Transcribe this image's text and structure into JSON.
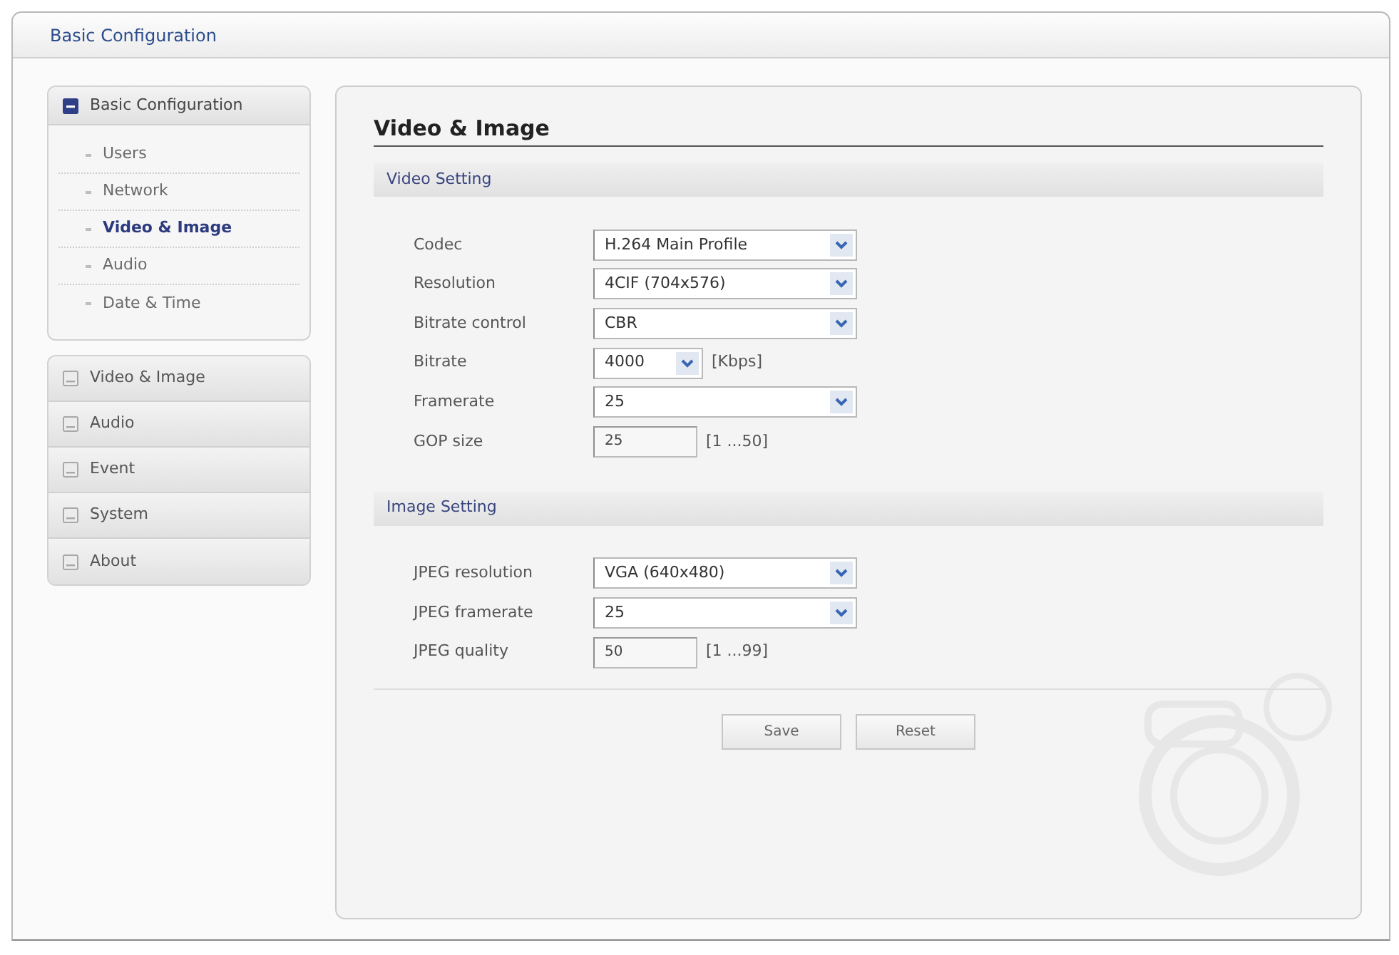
{
  "window": {
    "title": "Basic Configuration"
  },
  "sidebar": {
    "groups": [
      {
        "label": "Basic Configuration",
        "expanded": true,
        "items": [
          {
            "label": "Users",
            "selected": false
          },
          {
            "label": "Network",
            "selected": false
          },
          {
            "label": "Video & Image",
            "selected": true
          },
          {
            "label": "Audio",
            "selected": false
          },
          {
            "label": "Date & Time",
            "selected": false
          }
        ]
      },
      {
        "label": "Video & Image",
        "expanded": false
      },
      {
        "label": "Audio",
        "expanded": false
      },
      {
        "label": "Event",
        "expanded": false
      },
      {
        "label": "System",
        "expanded": false
      },
      {
        "label": "About",
        "expanded": false
      }
    ]
  },
  "page": {
    "title": "Video & Image",
    "sections": [
      {
        "title": "Video Setting",
        "fields": [
          {
            "label": "Codec",
            "kind": "select",
            "value": "H.264 Main Profile"
          },
          {
            "label": "Resolution",
            "kind": "select",
            "value": "4CIF (704x576)"
          },
          {
            "label": "Bitrate control",
            "kind": "select",
            "value": "CBR"
          },
          {
            "label": "Bitrate",
            "kind": "select",
            "value": "4000",
            "unit": "[Kbps]"
          },
          {
            "label": "Framerate",
            "kind": "select",
            "value": "25"
          },
          {
            "label": "GOP size",
            "kind": "input",
            "value": "25",
            "unit": "[1 ...50]"
          }
        ]
      },
      {
        "title": "Image Setting",
        "fields": [
          {
            "label": "JPEG resolution",
            "kind": "select",
            "value": "VGA (640x480)"
          },
          {
            "label": "JPEG framerate",
            "kind": "select",
            "value": "25"
          },
          {
            "label": "JPEG quality",
            "kind": "input",
            "value": "50",
            "unit": "[1 ...99]"
          }
        ]
      }
    ]
  },
  "buttons": [
    "Save",
    "Reset"
  ]
}
